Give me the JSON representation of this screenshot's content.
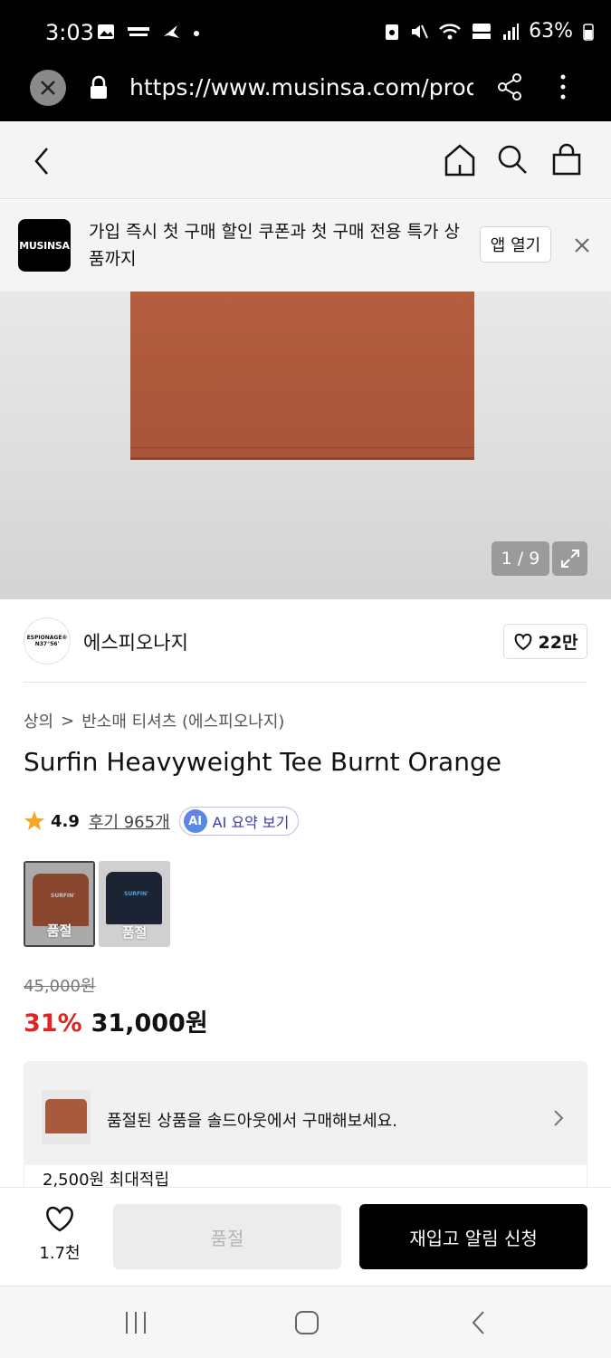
{
  "status_bar": {
    "time": "3:03",
    "battery": "63%",
    "notification_icons": [
      "image-icon",
      "kasina-icon",
      "nike-icon",
      "dot-icon"
    ],
    "system_icons": [
      "battery-saver-icon",
      "mute-icon",
      "wifi-icon",
      "hd-voice-icon",
      "signal-icon",
      "battery-icon"
    ]
  },
  "browser": {
    "url": "https://www.musinsa.com/produ"
  },
  "promo_banner": {
    "logo_text": "MUSINSA",
    "message": "가입 즉시 첫 구매 할인 쿠폰과 첫 구매 전용 특가 상품까지",
    "open_app_label": "앱 열기"
  },
  "gallery": {
    "counter": "1 / 9"
  },
  "brand": {
    "logo_text": "ESPIONAGE® N37°56'",
    "name": "에스피오나지",
    "likes": "22만"
  },
  "breadcrumb": {
    "category": "상의",
    "separator": ">",
    "subcategory": "반소매 티셔츠 (에스피오나지)"
  },
  "product": {
    "title": "Surfin Heavyweight Tee Burnt Orange",
    "rating": "4.9",
    "reviews": "후기 965개",
    "ai_badge": "AI",
    "ai_summary_label": "AI 요약 보기",
    "options": [
      {
        "color_hex": "#a9553a",
        "tee_text": "SURFIN'",
        "status": "품절",
        "selected": true
      },
      {
        "color_hex": "#1c2433",
        "tee_text": "SURFIN'",
        "status": "품절",
        "selected": false
      }
    ],
    "original_price": "45,000원",
    "discount": "31%",
    "price": "31,000원"
  },
  "soldout_notice": {
    "message": "품절된 상품을 솔드아웃에서 구매해보세요."
  },
  "points": {
    "text": "2,500원 최대적립"
  },
  "action_bar": {
    "wish_count": "1.7천",
    "soldout_label": "품절",
    "notify_label": "재입고 알림 신청"
  },
  "colors": {
    "discount_red": "#e02424",
    "primary_black": "#000000",
    "product_orange": "#a9553a"
  }
}
